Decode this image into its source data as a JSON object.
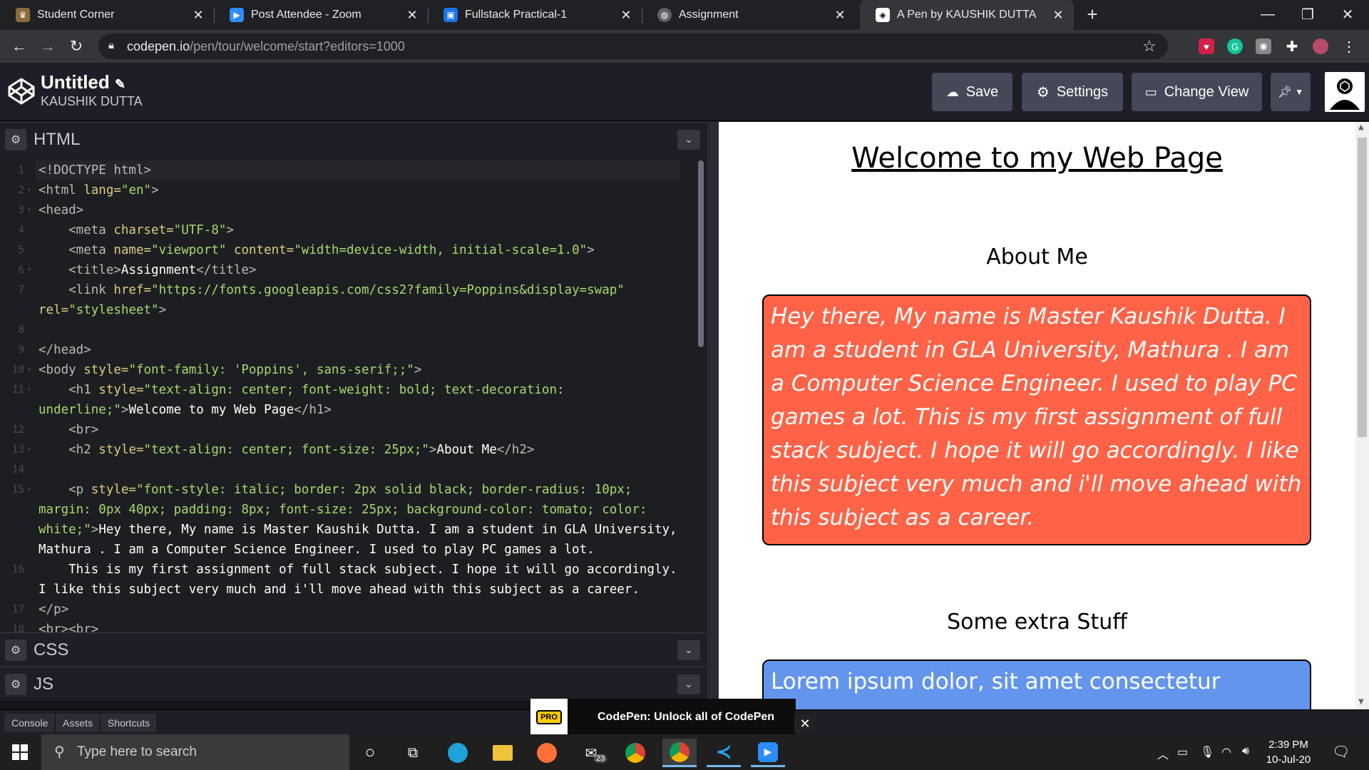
{
  "browser": {
    "tabs": [
      {
        "title": "Student Corner",
        "favicon_color": "#8a6d3b",
        "favicon_icon": "student-icon",
        "active": false
      },
      {
        "title": "Post Attendee - Zoom",
        "favicon_color": "#2d8cff",
        "favicon_icon": "zoom-icon",
        "active": false
      },
      {
        "title": "Fullstack Practical-1",
        "favicon_color": "#1a73e8",
        "favicon_icon": "classroom-icon",
        "active": false
      },
      {
        "title": "Assignment",
        "favicon_color": "#5f6368",
        "favicon_icon": "globe-icon",
        "active": false
      },
      {
        "title": "A Pen by KAUSHIK DUTTA",
        "favicon_color": "#ffffff",
        "favicon_icon": "codepen-icon",
        "active": true
      }
    ],
    "url_host": "codepen.io",
    "url_path": "/pen/tour/welcome/start?editors=1000"
  },
  "codepen": {
    "pen_title": "Untitled",
    "author": "KAUSHIK DUTTA",
    "buttons": {
      "save": "Save",
      "settings": "Settings",
      "change_view": "Change View"
    },
    "panels": {
      "html": "HTML",
      "css": "CSS",
      "js": "JS"
    },
    "bottom": {
      "console": "Console",
      "assets": "Assets",
      "shortcuts": "Shortcuts"
    },
    "promo": {
      "badge": "PRO",
      "text": "CodePen: Unlock all of CodePen",
      "close": "✕"
    }
  },
  "code_lines": [
    {
      "n": "1",
      "segments": [
        [
          "tg",
          "<!DOCTYPE html>"
        ]
      ]
    },
    {
      "n": "2",
      "fold": true,
      "segments": [
        [
          "tg",
          "<html "
        ],
        [
          "at",
          "lang="
        ],
        [
          "st",
          "\"en\""
        ],
        [
          "tg",
          ">"
        ]
      ]
    },
    {
      "n": "3",
      "fold": true,
      "segments": [
        [
          "tg",
          "<head>"
        ]
      ]
    },
    {
      "n": "4",
      "segments": [
        [
          "tg",
          "    <meta "
        ],
        [
          "at",
          "charset="
        ],
        [
          "st",
          "\"UTF-8\""
        ],
        [
          "tg",
          ">"
        ]
      ]
    },
    {
      "n": "5",
      "segments": [
        [
          "tg",
          "    <meta "
        ],
        [
          "at",
          "name="
        ],
        [
          "st",
          "\"viewport\" "
        ],
        [
          "at",
          "content="
        ],
        [
          "st",
          "\"width=device-width, initial-scale=1.0\""
        ],
        [
          "tg",
          ">"
        ]
      ]
    },
    {
      "n": "6",
      "fold": true,
      "segments": [
        [
          "tg",
          "    <title>"
        ],
        [
          "tx",
          "Assignment"
        ],
        [
          "tg",
          "</title>"
        ]
      ]
    },
    {
      "n": "7",
      "segments": [
        [
          "tg",
          "    <link "
        ],
        [
          "at",
          "href="
        ],
        [
          "st",
          "\"https://fonts.googleapis.com/css2?family=Poppins&display=swap\""
        ]
      ]
    },
    {
      "n": "",
      "segments": [
        [
          "at",
          "rel="
        ],
        [
          "st",
          "\"stylesheet\""
        ],
        [
          "tg",
          ">"
        ]
      ]
    },
    {
      "n": "8",
      "segments": []
    },
    {
      "n": "9",
      "segments": [
        [
          "tg",
          "</head>"
        ]
      ]
    },
    {
      "n": "10",
      "fold": true,
      "segments": [
        [
          "tg",
          "<body "
        ],
        [
          "at",
          "style="
        ],
        [
          "st",
          "\"font-family: 'Poppins', sans-serif;;\""
        ],
        [
          "tg",
          ">"
        ]
      ]
    },
    {
      "n": "11",
      "fold": true,
      "segments": [
        [
          "tg",
          "    <h1 "
        ],
        [
          "at",
          "style="
        ],
        [
          "st",
          "\"text-align: center; font-weight: bold; text-decoration:"
        ]
      ]
    },
    {
      "n": "",
      "segments": [
        [
          "st",
          "underline;\""
        ],
        [
          "tg",
          ">"
        ],
        [
          "tx",
          "Welcome to my Web Page"
        ],
        [
          "tg",
          "</h1>"
        ]
      ]
    },
    {
      "n": "12",
      "segments": [
        [
          "tg",
          "    <br>"
        ]
      ]
    },
    {
      "n": "13",
      "fold": true,
      "segments": [
        [
          "tg",
          "    <h2 "
        ],
        [
          "at",
          "style="
        ],
        [
          "st",
          "\"text-align: center; font-size: 25px;\""
        ],
        [
          "tg",
          ">"
        ],
        [
          "tx",
          "About Me"
        ],
        [
          "tg",
          "</h2>"
        ]
      ]
    },
    {
      "n": "14",
      "segments": []
    },
    {
      "n": "15",
      "fold": true,
      "segments": [
        [
          "tg",
          "    <p "
        ],
        [
          "at",
          "style="
        ],
        [
          "st",
          "\"font-style: italic; border: 2px solid black; border-radius: 10px;"
        ]
      ]
    },
    {
      "n": "",
      "segments": [
        [
          "st",
          "margin: 0px 40px; padding: 8px; font-size: 25px; background-color: tomato; color:"
        ]
      ]
    },
    {
      "n": "",
      "segments": [
        [
          "st",
          "white;\""
        ],
        [
          "tg",
          ">"
        ],
        [
          "tx",
          "Hey there, My name is Master Kaushik Dutta. I am a student in GLA University,"
        ]
      ]
    },
    {
      "n": "",
      "segments": [
        [
          "tx",
          "Mathura . I am a Computer Science Engineer. I used to play PC games a lot."
        ]
      ]
    },
    {
      "n": "16",
      "segments": [
        [
          "tx",
          "    This is my first assignment of full stack subject. I hope it will go accordingly."
        ]
      ]
    },
    {
      "n": "",
      "segments": [
        [
          "tx",
          "I like this subject very much and i'll move ahead with this subject as a career."
        ]
      ]
    },
    {
      "n": "17",
      "segments": [
        [
          "tg",
          "</p>"
        ]
      ]
    },
    {
      "n": "18",
      "segments": [
        [
          "tg",
          "<br><br>"
        ]
      ]
    }
  ],
  "preview": {
    "h1": "Welcome to my Web Page",
    "h2": "About Me",
    "p": "Hey there, My name is Master Kaushik Dutta. I am a student in GLA University, Mathura . I am a Computer Science Engineer. I used to play PC games a lot. This is my first assignment of full stack subject. I hope it will go accordingly. I like this subject very much and i'll move ahead with this subject as a career.",
    "h3": "Some extra Stuff",
    "p2": "Lorem ipsum dolor, sit amet consectetur",
    "p_bg": "#ff6347",
    "p2_bg": "#6495ed"
  },
  "taskbar": {
    "search_placeholder": "Type here to search",
    "mail_badge": "23",
    "time": "2:39 PM",
    "date": "10-Jul-20"
  }
}
